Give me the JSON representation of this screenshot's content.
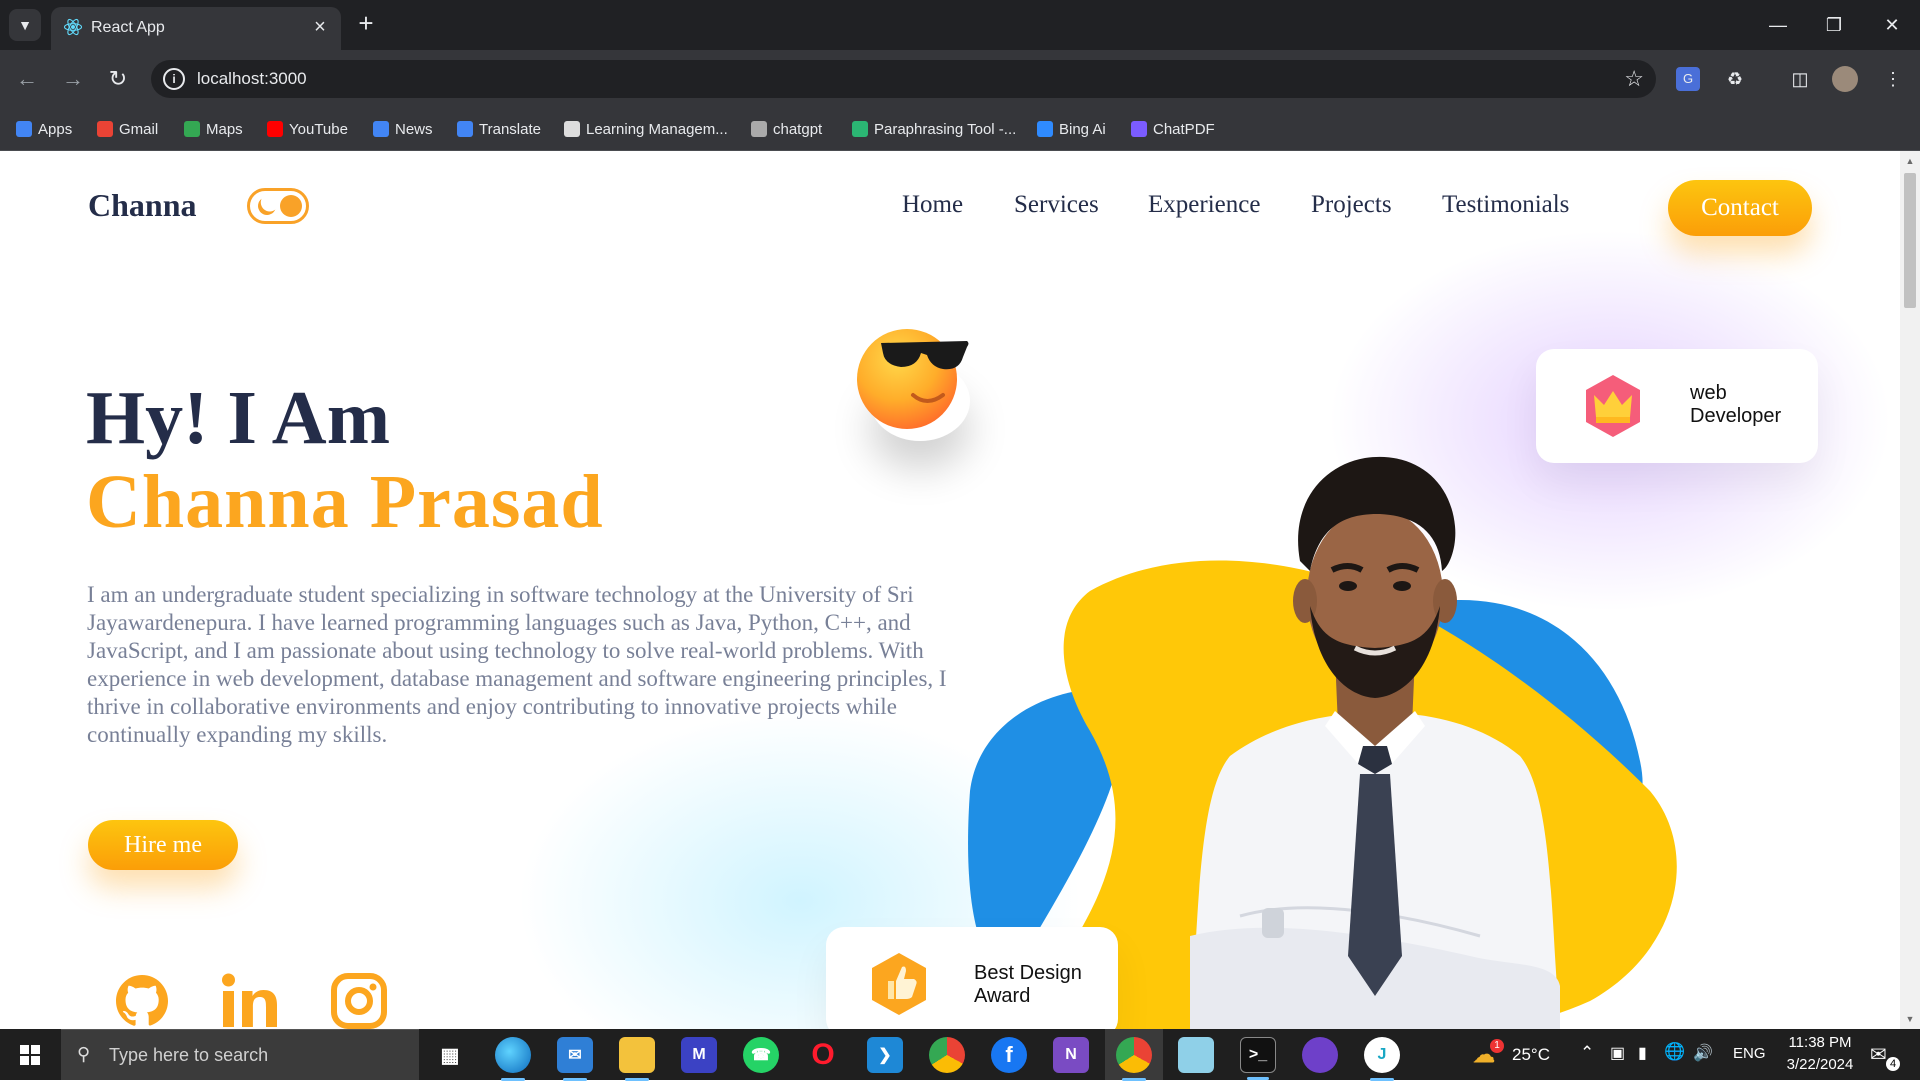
{
  "browser": {
    "tab_title": "React App",
    "url": "localhost:3000",
    "bookmarks": [
      {
        "label": "Apps",
        "color": "#4285f4"
      },
      {
        "label": "Gmail",
        "color": "#ea4335"
      },
      {
        "label": "Maps",
        "color": "#34a853"
      },
      {
        "label": "YouTube",
        "color": "#ff0000"
      },
      {
        "label": "News",
        "color": "#4285f4"
      },
      {
        "label": "Translate",
        "color": "#4285f4"
      },
      {
        "label": "Learning Managem...",
        "color": "#dddddd"
      },
      {
        "label": "chatgpt",
        "color": "#aaaaaa"
      },
      {
        "label": "Paraphrasing Tool -...",
        "color": "#2bb673"
      },
      {
        "label": "Bing Ai",
        "color": "#2f8bff"
      },
      {
        "label": "ChatPDF",
        "color": "#7b5cff"
      }
    ]
  },
  "site": {
    "logo": "Channa",
    "nav": [
      "Home",
      "Services",
      "Experience",
      "Projects",
      "Testimonials"
    ],
    "contact_label": "Contact",
    "hero": {
      "line1": "Hy! I Am",
      "line2": "Channa Prasad",
      "description": "I am an undergraduate student specializing in software technology at the University of Sri Jayawardenepura. I have learned programming languages such as Java, Python, C++, and JavaScript, and I am passionate about using technology to solve real-world problems. With experience in web development, database management and software engineering principles, I thrive in collaborative environments and enjoy contributing to innovative projects while continually expanding my skills.",
      "hire_label": "Hire me"
    },
    "cards": {
      "web_dev_line1": "web",
      "web_dev_line2": "Developer",
      "award_line1": "Best Design",
      "award_line2": "Award"
    },
    "colors": {
      "accent": "#fca61f",
      "dark": "#242d49",
      "blob_yellow": "#ffc808",
      "blob_blue": "#1f8fe5"
    }
  },
  "taskbar": {
    "search_placeholder": "Type here to search",
    "temperature": "25°C",
    "language": "ENG",
    "time": "11:38 PM",
    "date": "3/22/2024",
    "notification_count": "4",
    "weather_badge": "1"
  }
}
